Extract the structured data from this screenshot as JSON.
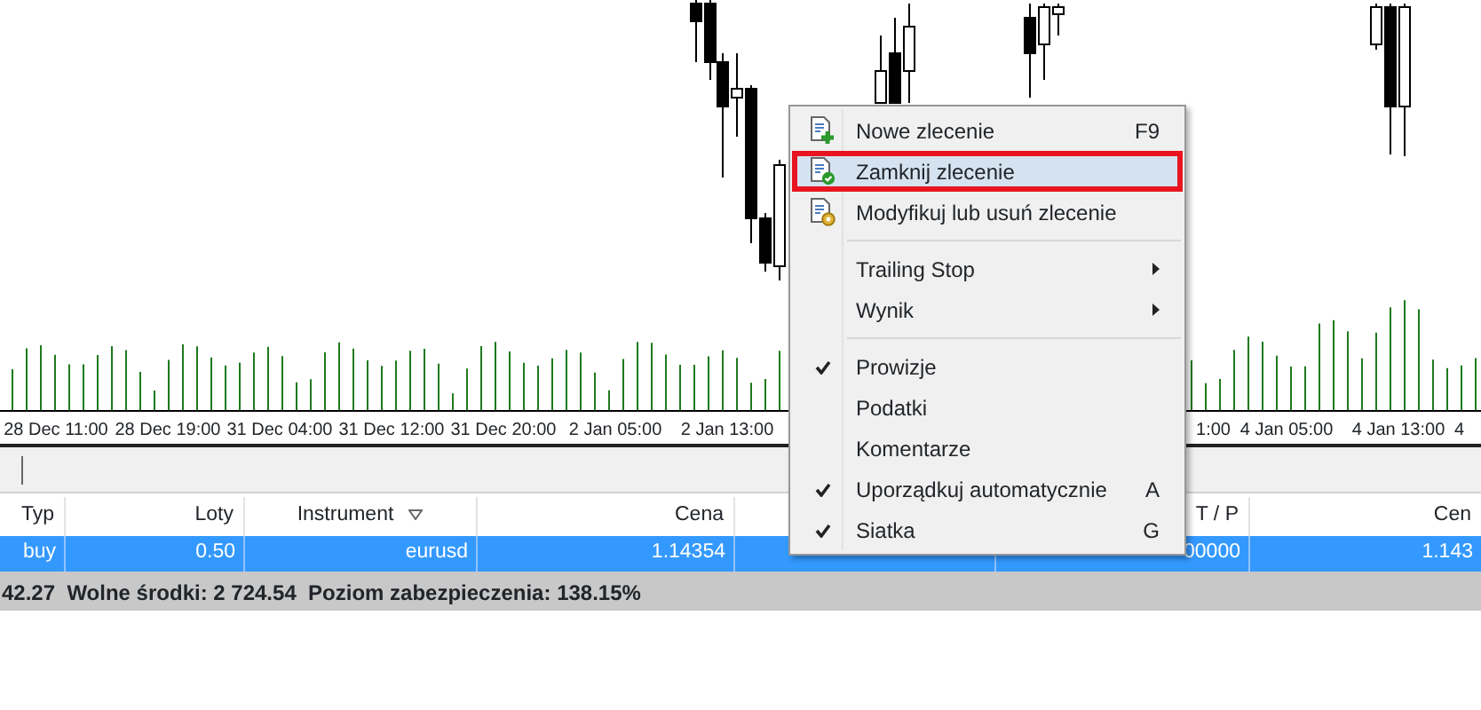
{
  "chart": {
    "time_labels": [
      {
        "text": "28 Dec 11:00"
      },
      {
        "text": "28 Dec 19:00"
      },
      {
        "text": "31 Dec 04:00"
      },
      {
        "text": "31 Dec 12:00"
      },
      {
        "text": "31 Dec 20:00"
      },
      {
        "text": "2 Jan 05:00"
      },
      {
        "text": "2 Jan 13:00"
      },
      {
        "text": "1:00"
      },
      {
        "text": "4 Jan 05:00"
      },
      {
        "text": "4 Jan 13:00"
      },
      {
        "text": "4"
      }
    ]
  },
  "table": {
    "columns": [
      {
        "label": "Typ"
      },
      {
        "label": "Loty"
      },
      {
        "label": "Instrument",
        "sorted": true
      },
      {
        "label": "Cena"
      },
      {},
      {
        "label": "T / P"
      },
      {
        "label": "Cen"
      }
    ],
    "rows": [
      {
        "selected": true,
        "cells": [
          "buy",
          "0.50",
          "eurusd",
          "1.14354",
          "",
          "00000",
          "1.143"
        ]
      }
    ]
  },
  "status_bar": {
    "text": "42.27  Wolne środki: 2 724.54  Poziom zabezpieczenia: 138.15%"
  },
  "context_menu": {
    "items": [
      {
        "kind": "add",
        "label": "Nowe zlecenie",
        "shortcut": "F9",
        "selected": false,
        "submenu": false
      },
      {
        "kind": "confirm",
        "label": "Zamknij zlecenie",
        "selected": true,
        "submenu": false
      },
      {
        "kind": "edit",
        "label": "Modyfikuj lub usuń zlecenie",
        "selected": false,
        "submenu": false
      },
      {
        "kind": "separator"
      },
      {
        "kind": "plain",
        "label": "Trailing Stop",
        "selected": false,
        "checked": false,
        "submenu": true
      },
      {
        "kind": "plain",
        "label": "Wynik",
        "selected": false,
        "checked": false,
        "submenu": true
      },
      {
        "kind": "separator"
      },
      {
        "kind": "plain",
        "label": "Prowizje",
        "selected": false,
        "checked": true,
        "submenu": false
      },
      {
        "kind": "plain",
        "label": "Podatki",
        "selected": false,
        "checked": false,
        "submenu": false
      },
      {
        "kind": "plain",
        "label": "Komentarze",
        "selected": false,
        "checked": false,
        "submenu": false
      },
      {
        "kind": "plain",
        "label": "Uporządkuj automatycznie",
        "shortcut": "A",
        "selected": false,
        "checked": true,
        "submenu": false
      },
      {
        "kind": "plain",
        "label": "Siatka",
        "shortcut": "G",
        "selected": false,
        "checked": true,
        "submenu": false
      }
    ]
  }
}
